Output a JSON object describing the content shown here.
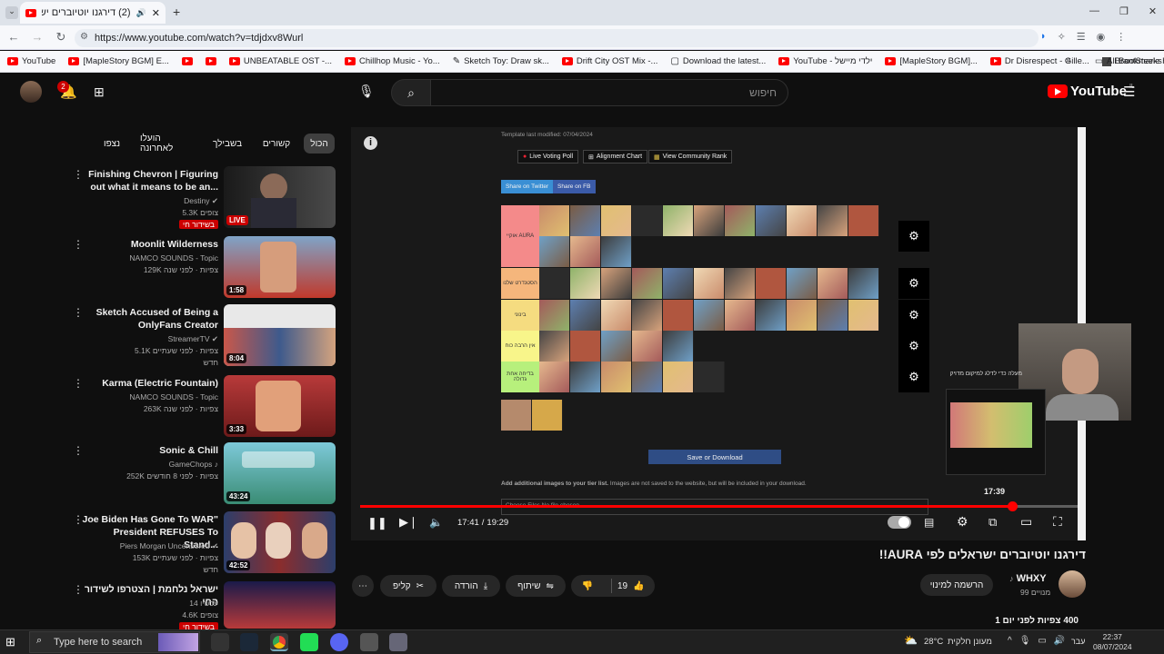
{
  "browser": {
    "tab_title": "(2) דירגנו יוטיוברים ישראלים",
    "url": "https://www.youtube.com/watch?v=tdjdxv8Wurl",
    "bookmarks": [
      "YouTube",
      "[MapleStory BGM] E...",
      "UNBEATABLE OST -...",
      "Chillhop Music - Yo...",
      "Sketch Toy: Draw sk...",
      "Drift City OST Mix -...",
      "Download the latest...",
      "YouTube - ילדי מיישל",
      "[MapleStory BGM]...",
      "Dr Disrespect - Gille...",
      "BrantSteele Hunger..."
    ],
    "all_bookmarks": "All Bookmarks"
  },
  "youtube": {
    "logo_text": "YouTube",
    "logo_region": "IL",
    "search_placeholder": "חיפוש",
    "notification_count": "2"
  },
  "chips": [
    "הכול",
    "קשורים",
    "בשבילך",
    "הועלו לאחרונה",
    "נצפו"
  ],
  "recommendations": [
    {
      "title": "Finishing Chevron | Figuring out what it means to be an...",
      "channel": "Destiny",
      "views": "5.3K צופים",
      "badge": "בשידור חי",
      "thumb_badge": "LIVE"
    },
    {
      "title": "Moonlit Wilderness",
      "channel": "NAMCO SOUNDS - Topic",
      "views": "129K צפיות · לפני שנה",
      "duration": "1:58"
    },
    {
      "title": "Sketch Accused of Being a OnlyFans Creator",
      "channel": "StreamerTV",
      "views": "5.1K צפיות · לפני שעתיים",
      "extra": "חדש",
      "duration": "8:04"
    },
    {
      "title": "Karma (Electric Fountain)",
      "channel": "NAMCO SOUNDS - Topic",
      "views": "263K צפיות · לפני שנה",
      "duration": "3:33"
    },
    {
      "title": "Sonic & Chill",
      "channel": "GameChops",
      "views": "252K צפיות · לפני 8 חודשים",
      "duration": "43:24"
    },
    {
      "title": "Joe Biden Has Gone To WAR\" President REFUSES To Stand...",
      "channel": "Piers Morgan Uncensored",
      "views": "153K צפיות · לפני שעתיים",
      "extra": "חדש",
      "duration": "42:52"
    },
    {
      "title": "ישראל נלחמת | הצטרפו לשידור החי",
      "channel": "עכשיו 14",
      "views": "4.6K צופים",
      "badge": "בשידור חי"
    }
  ],
  "player": {
    "template_modified": "Template last modified: 07/04/2024",
    "btn_voting": "Live Voting Poll",
    "btn_alignment": "Alignment Chart",
    "btn_rank": "View Community Rank",
    "share_twitter": "Share on Twitter",
    "share_fb": "Share on FB",
    "tier_labels": [
      "אוקיי AURA",
      "הסטנדרט שלנו",
      "בינוני",
      "אין הרבה כוח",
      "בדיחה אחת גדולה"
    ],
    "save_button": "Save or Download",
    "add_images": "Add additional images to your tier list.",
    "add_images_note": "Images are not saved to the website, but will be included in your download.",
    "file_input": "Choose Files  No file chosen",
    "overlay_text": "מעלה כדי לדלג למיקום מדויק",
    "time_current": "17:41",
    "time_total": "19:29",
    "hover_time": "17:39",
    "progress": 0.907,
    "hover_progress": 0.905
  },
  "video": {
    "title": "דירגנו יוטיוברים ישראלים לפי AURA!!",
    "channel": "WHXY",
    "subscribers": "99 מנויים",
    "subscribe_label": "הרשמה למינוי",
    "likes": "19",
    "share_label": "שיתוף",
    "download_label": "הורדה",
    "clip_label": "קליפ",
    "views_line": "400 צפיות  לפני יום 1"
  },
  "taskbar": {
    "search_placeholder": "Type here to search",
    "temperature": "28°C",
    "weather": "מעונן חלקית",
    "time": "22:37",
    "date": "08/07/2024",
    "lang": "עבר"
  }
}
